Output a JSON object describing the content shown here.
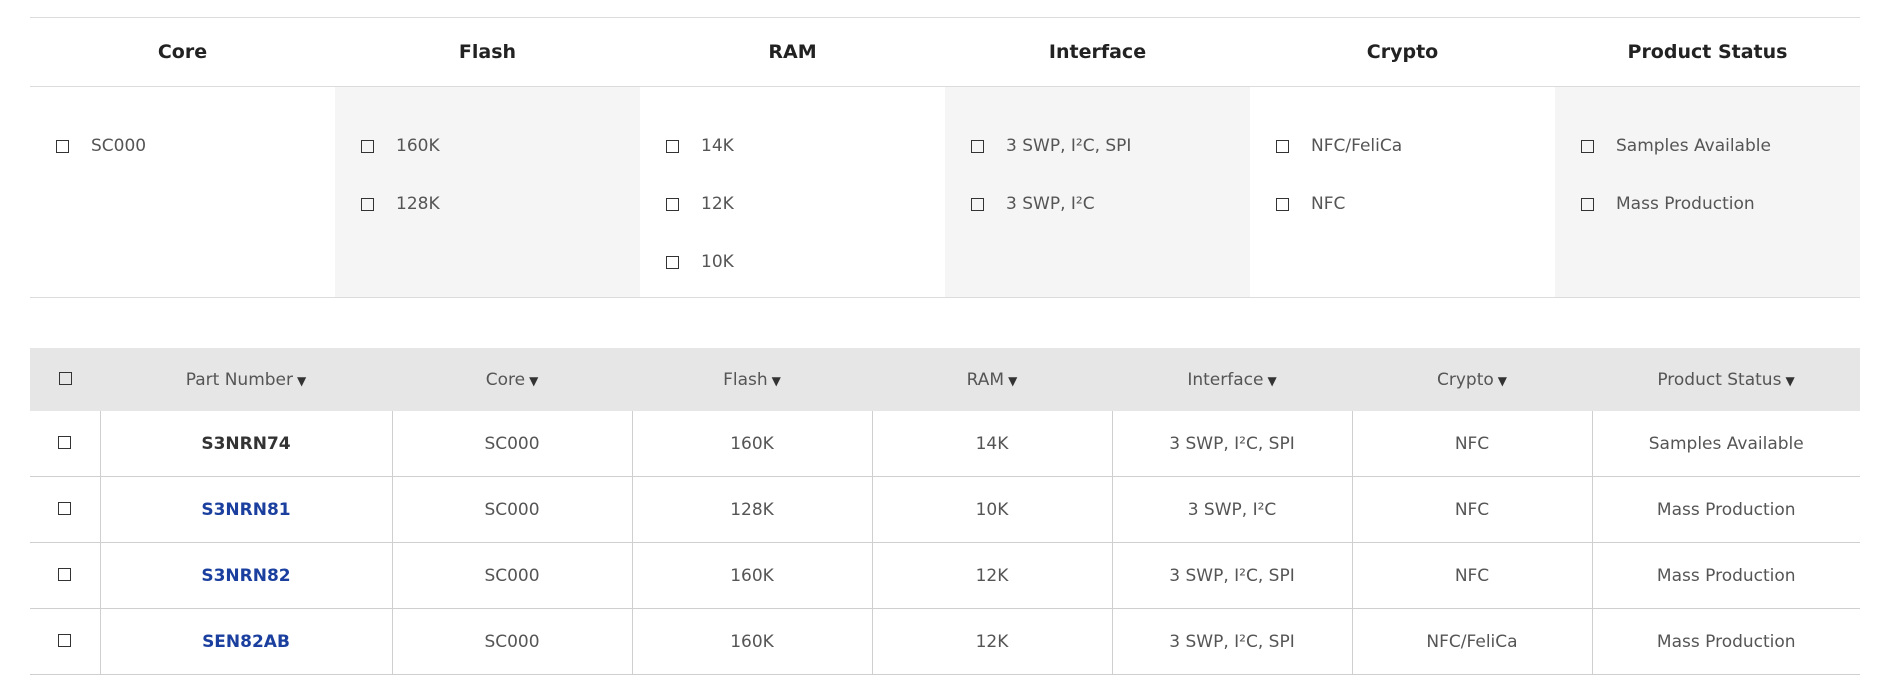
{
  "filters": {
    "headers": [
      "Core",
      "Flash",
      "RAM",
      "Interface",
      "Crypto",
      "Product Status"
    ],
    "columns": [
      [
        "SC000"
      ],
      [
        "160K",
        "128K"
      ],
      [
        "14K",
        "12K",
        "10K"
      ],
      [
        "3 SWP, I²C, SPI",
        "3 SWP, I²C"
      ],
      [
        "NFC/FeliCa",
        "NFC"
      ],
      [
        "Samples Available",
        "Mass Production"
      ]
    ]
  },
  "table": {
    "headers": [
      "Part Number",
      "Core",
      "Flash",
      "RAM",
      "Interface",
      "Crypto",
      "Product Status"
    ],
    "sort_glyph": "▼",
    "rows": [
      [
        "S3NRN74",
        "SC000",
        "160K",
        "14K",
        "3 SWP, I²C, SPI",
        "NFC",
        "Samples Available"
      ],
      [
        "S3NRN81",
        "SC000",
        "128K",
        "10K",
        "3 SWP, I²C",
        "NFC",
        "Mass Production"
      ],
      [
        "S3NRN82",
        "SC000",
        "160K",
        "12K",
        "3 SWP, I²C, SPI",
        "NFC",
        "Mass Production"
      ],
      [
        "SEN82AB",
        "SC000",
        "160K",
        "12K",
        "3 SWP, I²C, SPI",
        "NFC/FeliCa",
        "Mass Production"
      ]
    ],
    "link_color": "#1a3f9e"
  }
}
